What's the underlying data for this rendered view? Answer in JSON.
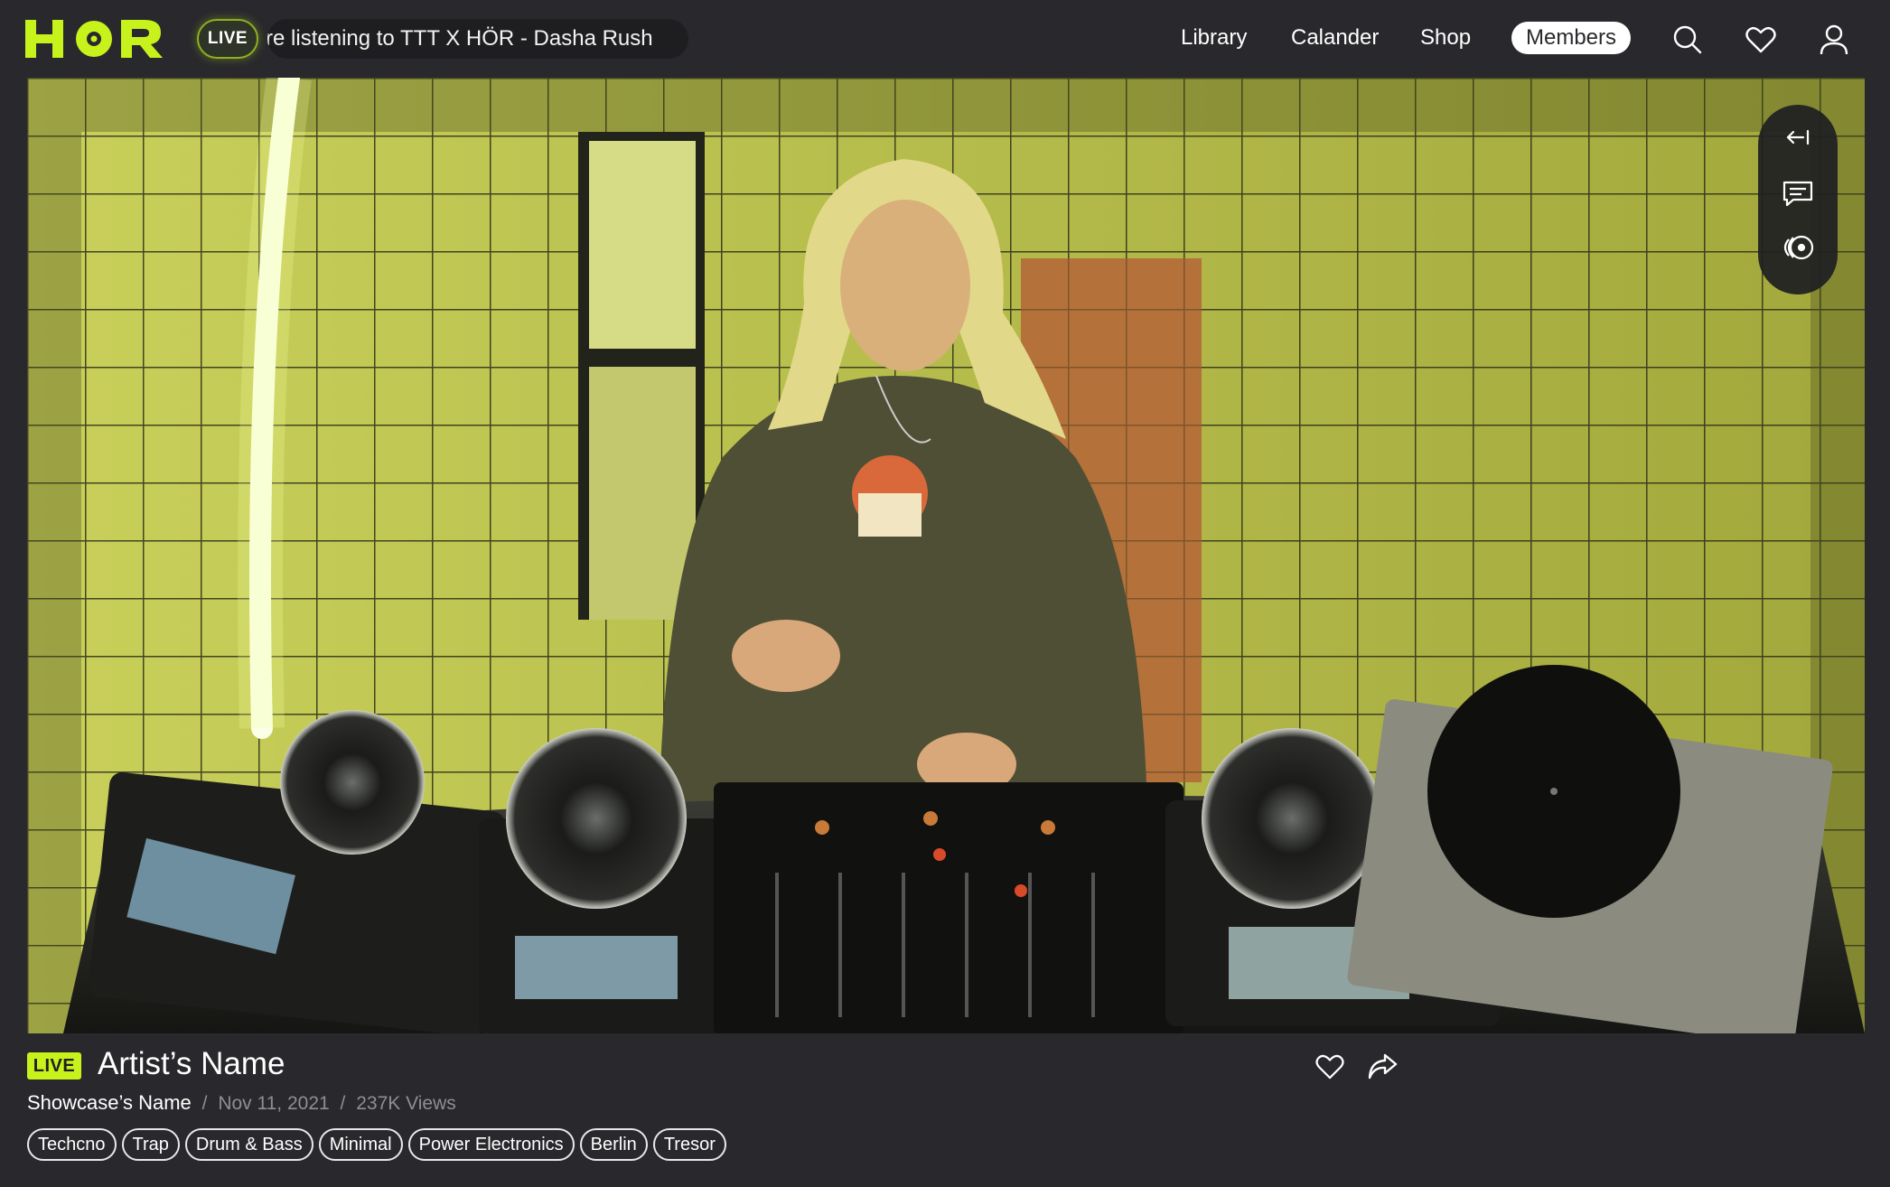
{
  "header": {
    "logo_text": "HÖR",
    "live_label": "LIVE",
    "now_playing": "ou’re listening to TTT X HÖR - Dasha Rush",
    "nav": {
      "library": "Library",
      "calendar": "Calander",
      "shop": "Shop",
      "members": "Members"
    },
    "icons": [
      "search-icon",
      "heart-icon",
      "user-icon"
    ]
  },
  "video": {
    "side_controls": [
      "collapse-arrow-icon",
      "chat-icon",
      "record-icon"
    ]
  },
  "info": {
    "live_badge": "LIVE",
    "artist_name": "Artist’s Name",
    "showcase_name": "Showcase’s Name",
    "separator": "/",
    "date": "Nov 11, 2021",
    "views": "237K Views",
    "actions": [
      "heart-icon",
      "share-icon"
    ],
    "tags": [
      "Techcno",
      "Trap",
      "Drum & Bass",
      "Minimal",
      "Power Electronics",
      "Berlin",
      "Tresor"
    ]
  },
  "colors": {
    "background": "#29292d",
    "accent": "#c8f21b",
    "text": "#ffffff",
    "muted": "#8e8e93"
  }
}
